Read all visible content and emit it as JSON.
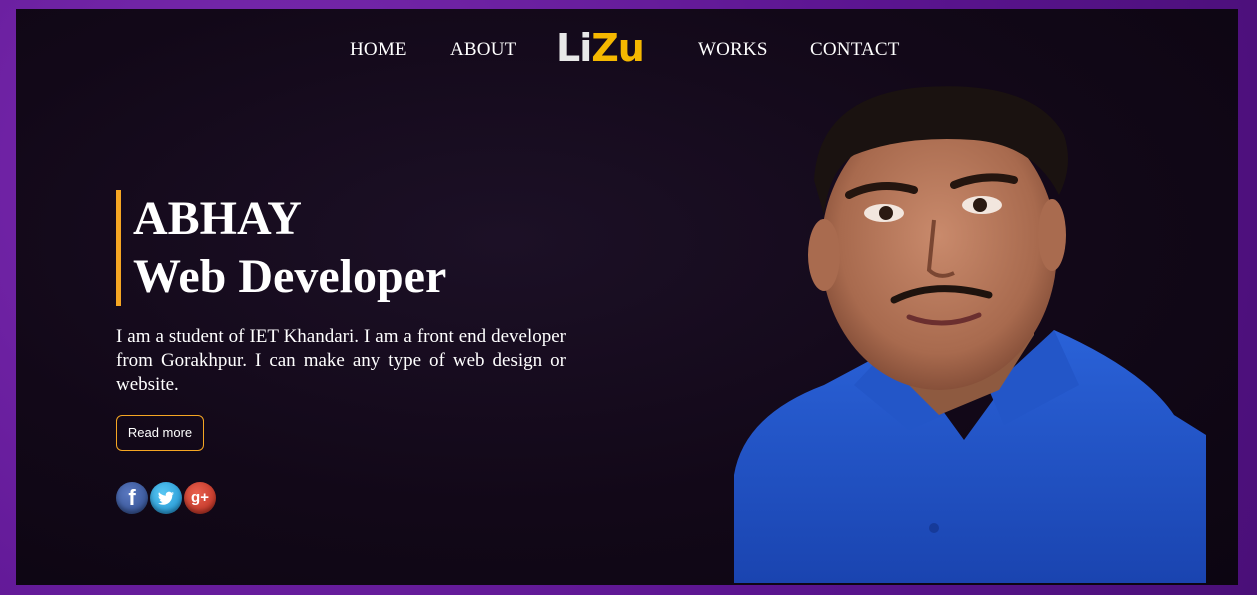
{
  "nav": {
    "home": "HOME",
    "about": "ABOUT",
    "works": "WORKS",
    "contact": "CONTACT"
  },
  "logo": {
    "part1": "Li",
    "part2": "Zu"
  },
  "hero": {
    "name": "ABHAY",
    "role": "Web Developer",
    "bio": "I am a student of IET Khandari. I am a front end developer from Gorakhpur. I can make any type of web design or website.",
    "read_more": "Read more"
  },
  "social": {
    "facebook": "f",
    "twitter": "t",
    "google_plus": "g+"
  },
  "colors": {
    "accent": "#f5a623",
    "logo_yellow": "#f5b800",
    "background": "#120818",
    "border_purple": "#6a1b9a",
    "shirt_blue": "#1d4fc4"
  }
}
